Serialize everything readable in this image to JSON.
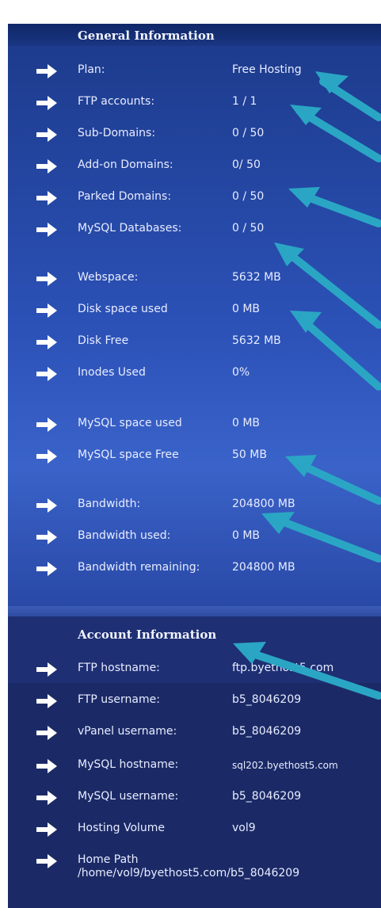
{
  "general": {
    "heading": "General Information",
    "rows": [
      {
        "label": "Plan:",
        "value": "Free Hosting"
      },
      {
        "label": "FTP accounts:",
        "value": "1 / 1"
      },
      {
        "label": "Sub-Domains:",
        "value": "0 / 50"
      },
      {
        "label": "Add-on Domains:",
        "value": "0/ 50"
      },
      {
        "label": "Parked Domains:",
        "value": "0 / 50"
      },
      {
        "label": "MySQL Databases:",
        "value": "0 / 50"
      },
      {
        "label": "Webspace:",
        "value": "5632 MB"
      },
      {
        "label": "Disk space used",
        "value": "0 MB"
      },
      {
        "label": "Disk Free",
        "value": "5632 MB"
      },
      {
        "label": "Inodes Used",
        "value": "0%"
      },
      {
        "label": "MySQL space used",
        "value": "0 MB"
      },
      {
        "label": "MySQL space Free",
        "value": "50 MB"
      },
      {
        "label": "Bandwidth:",
        "value": "204800 MB"
      },
      {
        "label": "Bandwidth used:",
        "value": "0 MB"
      },
      {
        "label": "Bandwidth remaining:",
        "value": "204800 MB"
      }
    ]
  },
  "account": {
    "heading": "Account Information",
    "rows": [
      {
        "label": "FTP hostname:",
        "value": "ftp.byethost5.com"
      },
      {
        "label": "FTP username:",
        "value": "b5_8046209"
      },
      {
        "label": "vPanel username:",
        "value": "b5_8046209"
      },
      {
        "label": "MySQL hostname:",
        "value": "sql202.byethost5.com"
      },
      {
        "label": "MySQL username:",
        "value": "b5_8046209"
      },
      {
        "label": "Hosting Volume",
        "value": "vol9"
      },
      {
        "label": "Home Path",
        "value": ""
      }
    ],
    "home_path": "/home/vol9/byethost5.com/b5_8046209"
  },
  "colors": {
    "panel_top": "#1c3a8a",
    "panel_mid": "#3a63c9",
    "text": "#e8ecff",
    "annotation_arrow": "#2aa6c4"
  },
  "icons": {
    "row_marker": "right-arrow-icon",
    "annotation": "annotation-arrow"
  }
}
